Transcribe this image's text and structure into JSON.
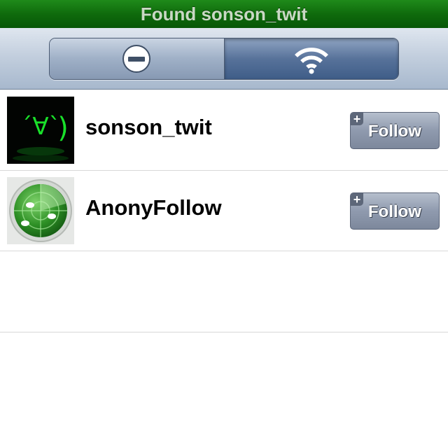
{
  "window": {
    "title": "Found sonson_twit"
  },
  "toolbar": {
    "segments": [
      {
        "icon": "minus-circle-icon",
        "selected": false
      },
      {
        "icon": "wifi-icon",
        "selected": true
      }
    ]
  },
  "users": [
    {
      "name": "sonson_twit",
      "avatar_icon": "kaomoji-avatar-icon",
      "follow_label": "Follow",
      "badge": "+"
    },
    {
      "name": "AnonyFollow",
      "avatar_icon": "radar-avatar-icon",
      "follow_label": "Follow",
      "badge": "+"
    }
  ],
  "colors": {
    "titlebar": "#0f6b0c",
    "follow_button": "#8f9aae",
    "selected_segment": "#57729a"
  }
}
